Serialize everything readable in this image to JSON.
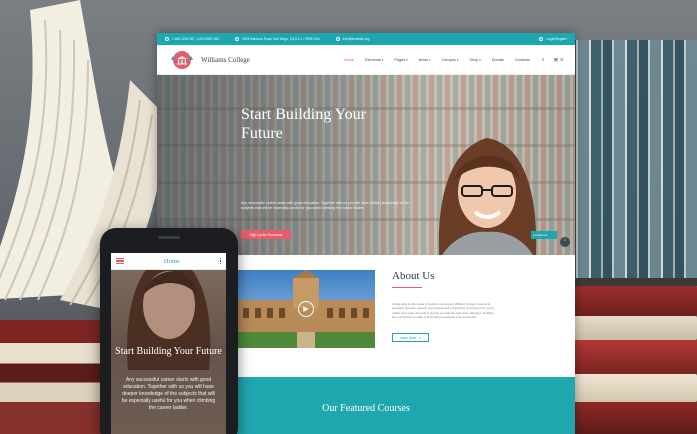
{
  "colors": {
    "accent_teal": "#1fa7b0",
    "accent_coral": "#e55c6a",
    "dark_text": "#2f3b40"
  },
  "topbar": {
    "phone": "1-800-1234-567, 1-800-5557-551",
    "address": "4578 Marmora Road, San Diego, CA 9-1-1 • 9999 USA",
    "email": "info@demolink.org",
    "login": "Login/Register"
  },
  "brand": {
    "name": "Williams College",
    "logo_icon": "college-building-icon"
  },
  "nav": {
    "items": [
      {
        "label": "Home",
        "dropdown": false
      },
      {
        "label": "Elements",
        "dropdown": true
      },
      {
        "label": "Pages",
        "dropdown": true
      },
      {
        "label": "News",
        "dropdown": true
      },
      {
        "label": "Campus",
        "dropdown": true
      },
      {
        "label": "Shop",
        "dropdown": true
      },
      {
        "label": "Donate",
        "dropdown": false
      },
      {
        "label": "Contacts",
        "dropdown": false
      }
    ],
    "search_icon": "search-icon",
    "cart_icon": "cart-icon",
    "cart_count": "0"
  },
  "hero": {
    "title": "Start Building Your Future",
    "text": "Any successful career starts with good education. Together with us you will have deeper knowledge of the subjects that will be especially useful for you when climbing the career ladder.",
    "button": "Sign Up for Excursion",
    "contact_tab": "Contact us",
    "scroll_icon": "arrow-up-icon"
  },
  "about": {
    "title": "About Us",
    "text": "Outstanding for the needs of students and society, Williams College's access to education provides, relevant opportunities and a supportive environment for you to realize your goals, the work to provide you with the right tools, pathways, flexibility, and connections to make your studying experience more successful.",
    "button": "Learn More",
    "play_icon": "play-icon"
  },
  "courses": {
    "title": "Our Featured Courses"
  },
  "phone": {
    "bar_title": "Home",
    "menu_icon": "hamburger-icon",
    "more_icon": "more-vertical-icon",
    "hero_title": "Start Building Your Future",
    "hero_text": "Any successful career starts with good education. Together with us you will have deeper knowledge of the subjects that will be especially useful for you when climbing the career ladder."
  }
}
